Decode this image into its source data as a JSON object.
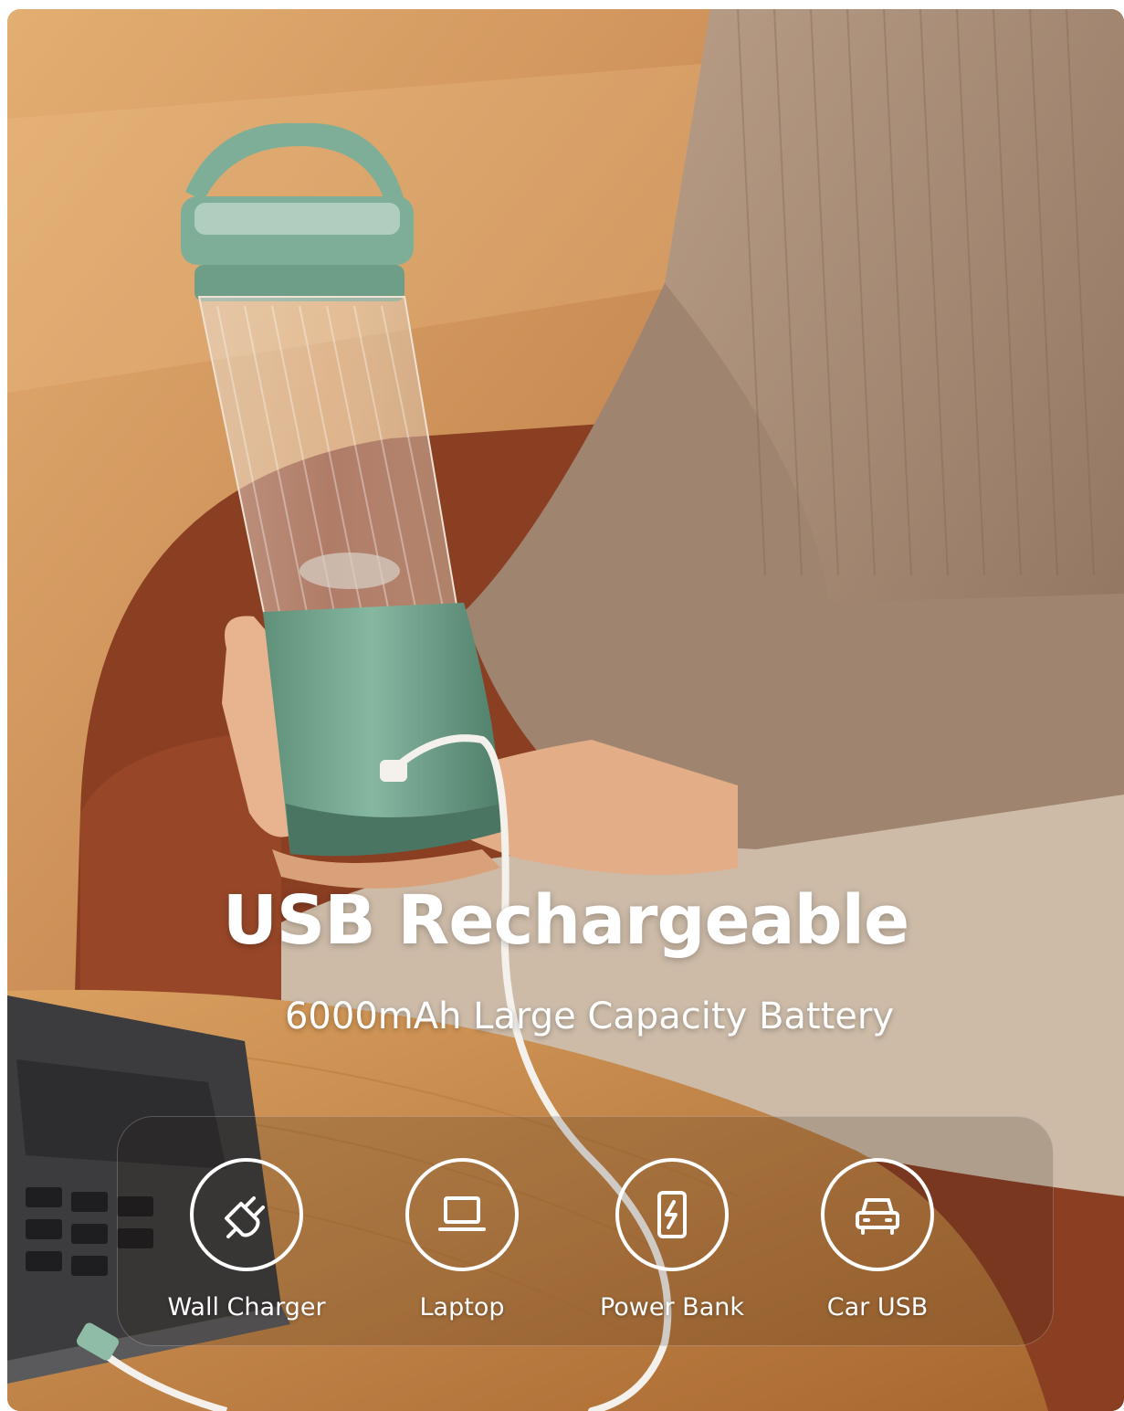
{
  "headline": "USB Rechargeable",
  "subheadline": "6000mAh Large Capacity Battery",
  "charging_sources": [
    {
      "label": "Wall Charger",
      "icon": "plug-icon"
    },
    {
      "label": "Laptop",
      "icon": "laptop-icon"
    },
    {
      "label": "Power Bank",
      "icon": "power-bank-icon"
    },
    {
      "label": "Car USB",
      "icon": "car-icon"
    }
  ],
  "colors": {
    "blender_green": "#7fae98",
    "sweater": "#a88a74",
    "chair": "#8a3e22",
    "table": "#c98a4a",
    "text": "#ffffff"
  }
}
